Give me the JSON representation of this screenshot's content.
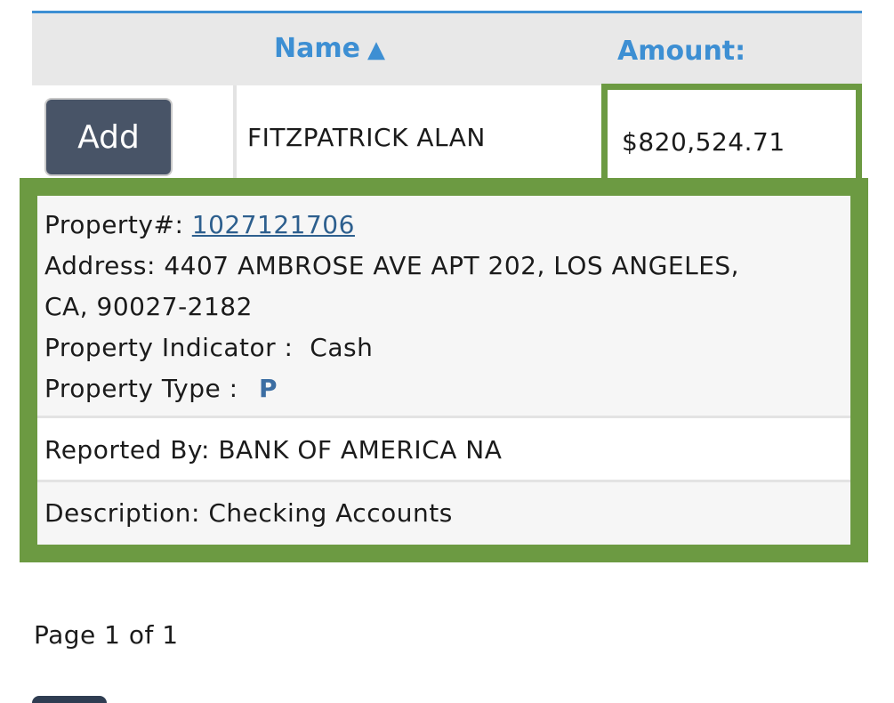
{
  "table": {
    "headers": {
      "name": "Name",
      "name_sort_indicator": "▲",
      "amount": "Amount:"
    },
    "row": {
      "add_label": "Add",
      "name": "FITZPATRICK ALAN",
      "amount": "$820,524.71"
    }
  },
  "details": {
    "property_label": "Property#:",
    "property_number": "1027121706",
    "address_label": "Address:",
    "address_line1": "4407 AMBROSE AVE APT 202, LOS ANGELES,",
    "address_line2": "CA, 90027-2182",
    "indicator_label": "Property Indicator :",
    "indicator_value": "Cash",
    "type_label": "Property Type :",
    "type_value": "P",
    "reported_label": "Reported By:",
    "reported_value": "BANK OF AMERICA NA",
    "description_label": "Description:",
    "description_value": "Checking Accounts"
  },
  "pager": {
    "text": "Page 1 of 1"
  },
  "colors": {
    "accent_blue": "#3d8fd3",
    "highlight_green": "#6c9a42",
    "button_slate": "#485467",
    "link_blue": "#2d5f8e"
  }
}
